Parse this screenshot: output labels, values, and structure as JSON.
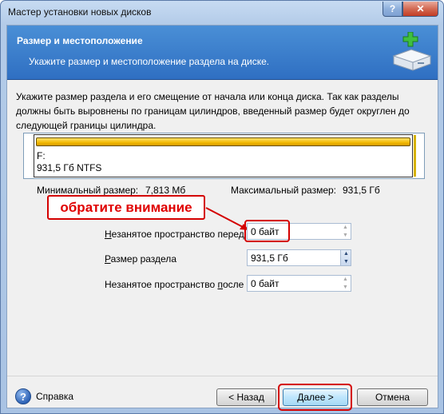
{
  "window": {
    "title": "Мастер установки новых дисков",
    "help_button": "?",
    "close_button": "✕"
  },
  "header": {
    "title": "Размер и местоположение",
    "subtitle": "Укажите размер и местоположение раздела на диске."
  },
  "description": "Укажите размер раздела и его смещение от начала или конца диска. Так как разделы должны быть выровнены по границам цилиндров, введенный размер будет округлен до следующей границы цилиндра.",
  "partition": {
    "letter": "F:",
    "info": "931,5 Гб  NTFS"
  },
  "sizes": {
    "min_label": "Минимальный размер:",
    "min_value": "7,813 Мб",
    "max_label": "Максимальный размер:",
    "max_value": "931,5 Гб"
  },
  "annotation": "обратите внимание",
  "fields": [
    {
      "label_pre": "",
      "label_u": "Н",
      "label_post": "езанятое пространство перед",
      "value": "0 байт"
    },
    {
      "label_pre": "",
      "label_u": "Р",
      "label_post": "азмер раздела",
      "value": "931,5 Гб"
    },
    {
      "label_pre": "Незанятое пространство ",
      "label_u": "п",
      "label_post": "осле",
      "value": "0 байт"
    }
  ],
  "footer": {
    "help_label": "Справка",
    "back": "< Назад",
    "next": "Далее >",
    "cancel": "Отмена"
  },
  "colors": {
    "header_bg": "#3a7fcc",
    "partition_bar": "#f2b800",
    "highlight": "#d40000"
  }
}
